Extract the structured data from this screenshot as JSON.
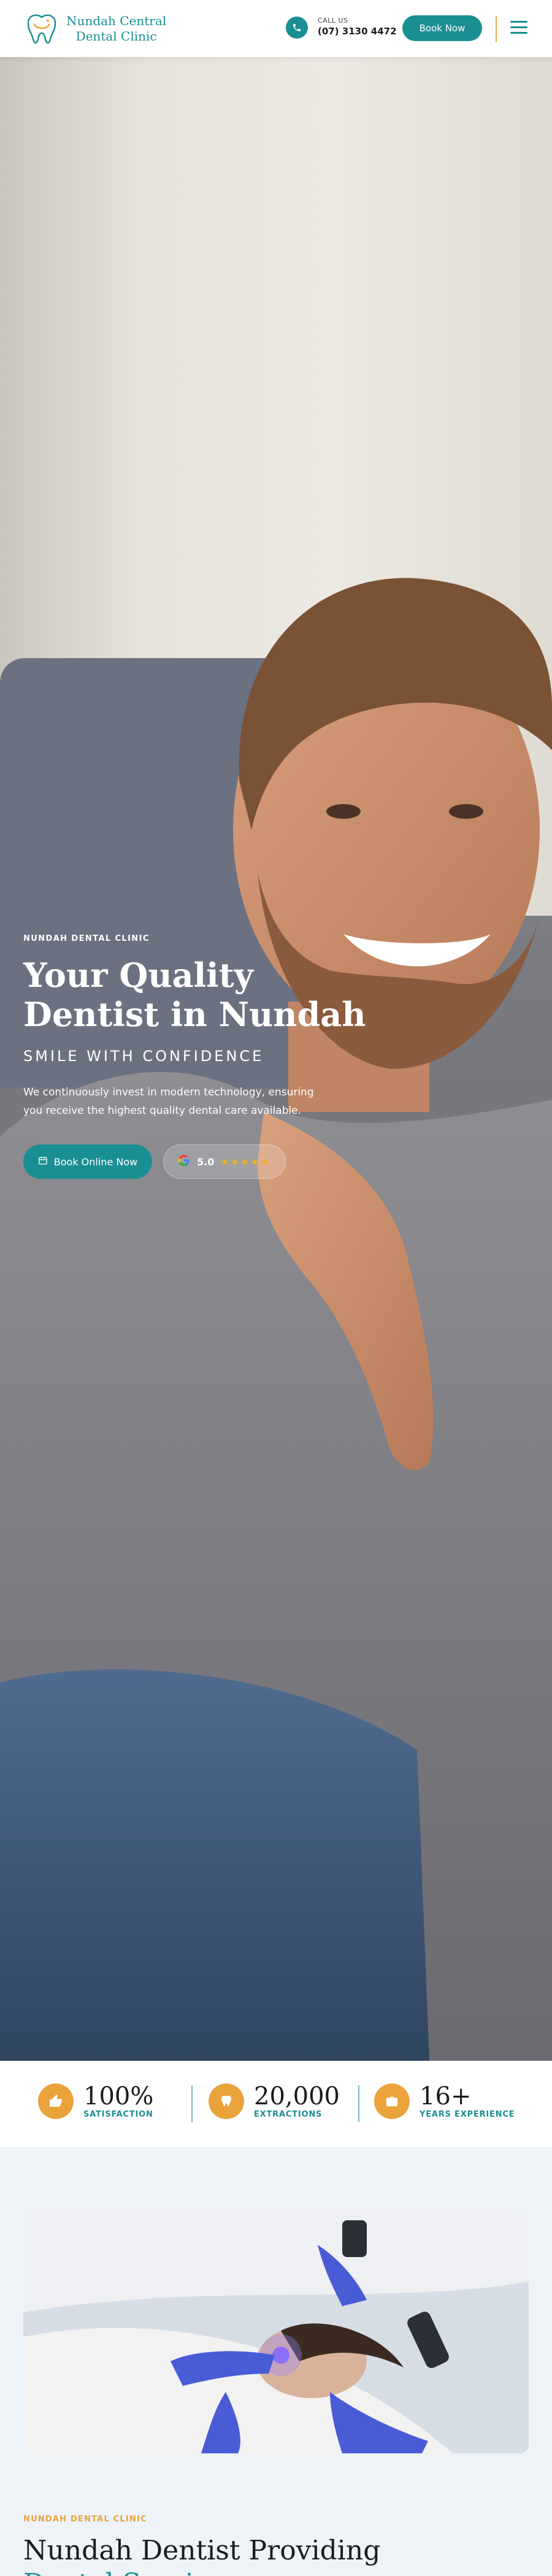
{
  "header": {
    "logo_line1": "Nundah Central",
    "logo_line2": "Dental Clinic",
    "call_label": "CALL US",
    "call_number": "(07) 3130 4472",
    "book_label": "Book Now",
    "icons": {
      "phone": "phone-icon",
      "menu": "hamburger-menu-icon",
      "logo": "tooth-logo-icon"
    }
  },
  "hero": {
    "tag": "NUNDAH DENTAL CLINIC",
    "title_line1": "Your Quality",
    "title_line2": "Dentist in Nundah",
    "subtitle": "SMILE WITH CONFIDENCE",
    "description": "We continuously invest in modern technology, ensuring you receive the highest quality dental care available.",
    "book_button": "Book Online Now",
    "rating": {
      "value": "5.0",
      "stars": 5,
      "source_icon": "google-icon"
    }
  },
  "stats": [
    {
      "value": "100%",
      "label": "SATISFACTION",
      "icon": "thumbs-up-icon"
    },
    {
      "value": "20,000",
      "label": "EXTRACTIONS",
      "icon": "tooth-icon"
    },
    {
      "value": "16+",
      "label": "YEARS EXPERIENCE",
      "icon": "briefcase-icon"
    }
  ],
  "about": {
    "tag": "NUNDAH DENTAL CLINIC",
    "title_line1": "Nundah Dentist Providing",
    "title_line2": "Dental Services"
  },
  "colors": {
    "brand": "#1a8f93",
    "accent": "#eaa33b",
    "star": "#f2b01e",
    "section_bg": "#eef3f8"
  }
}
